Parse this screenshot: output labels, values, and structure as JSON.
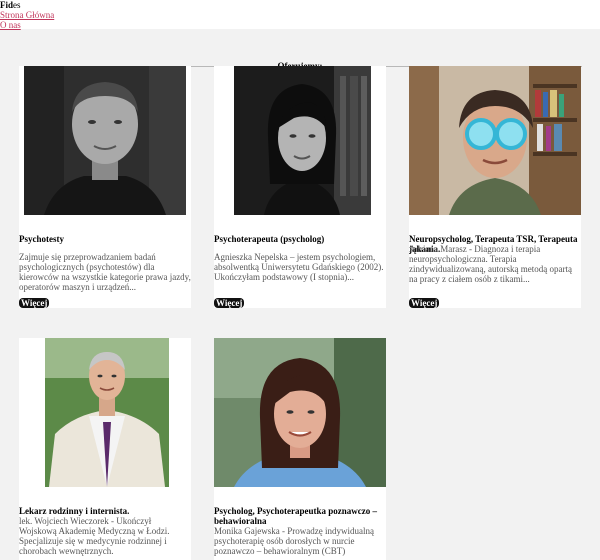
{
  "header": {
    "brand_main": "Fid",
    "brand_rest": "es",
    "nav": [
      {
        "label": "Strona Główna"
      },
      {
        "label": "O nas"
      }
    ]
  },
  "section": {
    "heading": "Oferujemy:"
  },
  "cards": [
    {
      "title": "Psychotesty",
      "description": "Zajmuje się przeprowadzaniem badań psychologicznych (psychotestów) dla kierowców na wszystkie kategorie prawa jazdy, operatorów maszyn i urządzeń...",
      "more": "Więcej"
    },
    {
      "title": "Psychoterapeuta (psycholog)",
      "description": "Agnieszka Nepelska – jestem psychologiem, absolwentką Uniwersytetu Gdańskiego (2002). Ukończyłam podstawowy (I stopnia)...",
      "more": "Więcej"
    },
    {
      "title": "Neuropsycholog, Terapeuta TSR, Terapeuta jąkania.",
      "description": "Adriana Marasz - Diagnoza i terapia neuropsychologiczna. Terapia zindywidualizowaną, autorską metodą opartą na pracy z ciałem osób z tikami...",
      "more": "Więcej"
    },
    {
      "title": "Lekarz rodzinny i internista.",
      "description": "lek. Wojciech Wieczorek - Ukończył Wojskową Akademię Medyczną w Łodzi. Specjalizuje się w medycynie rodzinnej i chorobach wewnętrznych."
    },
    {
      "title": "Psycholog, Psychoterapeutka poznawczo – behawioralna",
      "description": "Monika Gajewska - Prowadzę indywidualną psychoterapię osób dorosłych w nurcie poznawczo – behawioralnym (CBT)"
    }
  ]
}
